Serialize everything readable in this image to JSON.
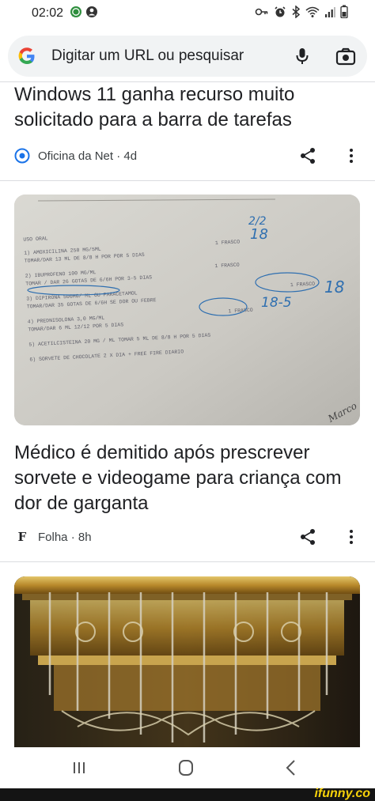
{
  "status_bar": {
    "time": "02:02",
    "left_icons": [
      "whatsapp-icon",
      "account-icon"
    ],
    "right_icons": [
      "key-icon",
      "alarm-icon",
      "bluetooth-icon",
      "wifi-icon",
      "signal-icon",
      "battery-icon"
    ]
  },
  "search": {
    "placeholder": "Digitar um URL ou pesquisar",
    "icons": [
      "google-g-icon",
      "mic-icon",
      "lens-icon"
    ]
  },
  "feed": {
    "cards": [
      {
        "title": "Windows 11 ganha recurso muito solicitado para a barra de tarefas",
        "source": "Oficina da Net · 4d"
      },
      {
        "title": "Médico é demitido após prescrever sorvete e videogame para criança com dor de garganta",
        "source": "Folha · 8h",
        "source_logo": "F",
        "image": {
          "header": "USO ORAL",
          "lines": [
            "1) AMOXICILINA 250 MG/5ML",
            "TOMAR/DAR 13 ML DE 8/8 H POR POR 5 DIAS",
            "2) IBUPROFENO 100 MG/ML",
            "TOMAR / DAR 26 GOTAS DE 6/6H POR 3-5 DIAS",
            "3) DIPIRONA 500MG/ ML OU PARACETAMOL",
            "TOMAR/DAR 35 GOTAS DE 6/6H SE DOR OU FEBRE",
            "4) PREDNISOLONA 3,0 MG/ML",
            "TOMAR/DAR 6 ML 12/12 POR 5 DIAS",
            "5) ACETILCISTEINA 20 MG / ML TOMAR 5 ML DE 8/8 H POR 5 DIAS",
            "6) SORVETE DE CHOCOLATE 2 X DIA + FREE FIRE DIARIO"
          ],
          "frasco": [
            "1 FRASCO",
            "1 FRASCO",
            "1 FRASCO",
            "1 FRASCO"
          ],
          "handwritten": [
            "2/2",
            "18",
            "18",
            "18-5"
          ],
          "signature": "Marco"
        }
      },
      {
        "image_alt": "quantum computer chandelier"
      }
    ]
  },
  "nav": {
    "icons": [
      "recents-icon",
      "home-icon",
      "back-icon"
    ]
  },
  "watermark": "ifunny.co",
  "colors": {
    "search_bg": "#f1f3f4",
    "divider": "#dadce0",
    "text": "#202124",
    "oficina_blue": "#1a73e8",
    "watermark_yellow": "#f6d10a"
  }
}
